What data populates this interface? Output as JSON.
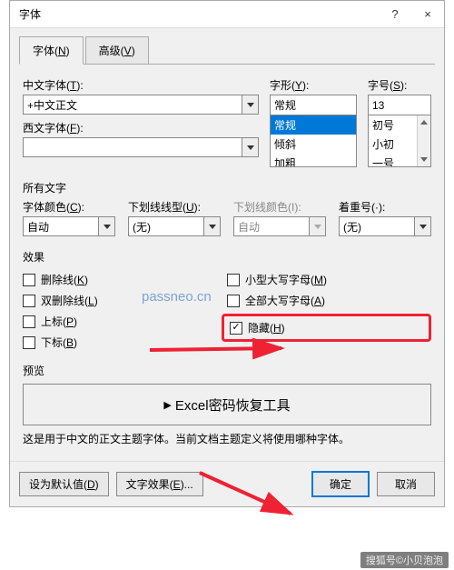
{
  "dialog": {
    "title": "字体",
    "help_tooltip": "?",
    "close_tooltip": "×"
  },
  "tabs": {
    "font": {
      "text": "字体(",
      "key": "N",
      "suffix": ")"
    },
    "advanced": {
      "text": "高级(",
      "key": "V",
      "suffix": ")"
    }
  },
  "fields": {
    "cjk_font": {
      "label_pre": "中文字体(",
      "key": "T",
      "label_post": "):",
      "value": "+中文正文"
    },
    "western_font": {
      "label_pre": "西文字体(",
      "key": "F",
      "label_post": "):",
      "value": ""
    },
    "style": {
      "label_pre": "字形(",
      "key": "Y",
      "label_post": "):",
      "value": "常规",
      "options": [
        "常规",
        "倾斜",
        "加粗"
      ]
    },
    "size": {
      "label_pre": "字号(",
      "key": "S",
      "label_post": "):",
      "value": "13",
      "options": [
        "初号",
        "小初",
        "一号"
      ]
    }
  },
  "all_text": {
    "label": "所有文字"
  },
  "color_fields": {
    "font_color": {
      "label_pre": "字体颜色(",
      "key": "C",
      "label_post": "):",
      "value": "自动"
    },
    "underline_style": {
      "label_pre": "下划线线型(",
      "key": "U",
      "label_post": "):",
      "value": "(无)"
    },
    "underline_color": {
      "label_pre": "下划线颜色(",
      "key": "I",
      "label_post": "):",
      "value": "自动"
    },
    "emphasis": {
      "label_pre": "着重号(",
      "key": "·",
      "label_post": "):",
      "value": "(无)"
    }
  },
  "effects": {
    "label": "效果",
    "strike": {
      "text": "删除线(",
      "key": "K",
      "suffix": ")",
      "checked": false
    },
    "dbl_strike": {
      "text": "双删除线(",
      "key": "L",
      "suffix": ")",
      "checked": false
    },
    "superscript": {
      "text": "上标(",
      "key": "P",
      "suffix": ")",
      "checked": false
    },
    "subscript": {
      "text": "下标(",
      "key": "B",
      "suffix": ")",
      "checked": false
    },
    "smallcaps": {
      "text": "小型大写字母(",
      "key": "M",
      "suffix": ")",
      "checked": false
    },
    "allcaps": {
      "text": "全部大写字母(",
      "key": "A",
      "suffix": ")",
      "checked": false
    },
    "hidden": {
      "text": "隐藏(",
      "key": "H",
      "suffix": ")",
      "checked": true
    }
  },
  "preview": {
    "label": "预览",
    "text": "Excel密码恢复工具"
  },
  "hint": "这是用于中文的正文主题字体。当前文档主题定义将使用哪种字体。",
  "buttons": {
    "set_default": {
      "text": "设为默认值(",
      "key": "D",
      "suffix": ")"
    },
    "text_effects": {
      "text": "文字效果(",
      "key": "E",
      "suffix": ")..."
    },
    "ok": "确定",
    "cancel": "取消"
  },
  "watermark": "passneo.cn",
  "credit": "搜狐号©小贝泡泡"
}
